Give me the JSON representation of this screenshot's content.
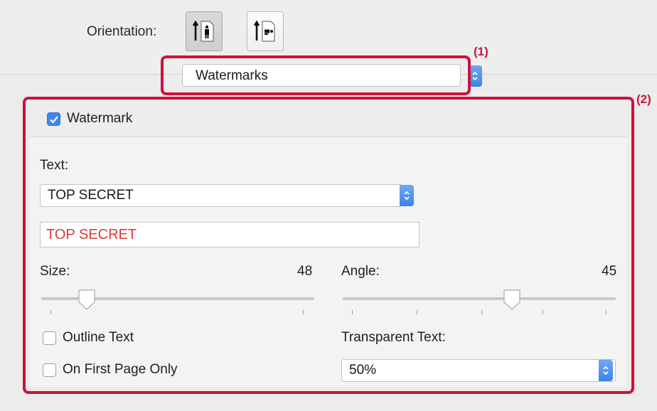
{
  "orientation": {
    "label": "Orientation:",
    "options": [
      "portrait-icon",
      "landscape-icon"
    ],
    "selected": "portrait-icon"
  },
  "panel_popup": {
    "value": "Watermarks"
  },
  "callouts": {
    "first": "(1)",
    "second": "(2)"
  },
  "watermark": {
    "checkbox_label": "Watermark",
    "checked": true,
    "text_label": "Text:",
    "text_popup_value": "TOP SECRET",
    "text_field_value": "TOP SECRET",
    "size": {
      "label": "Size:",
      "value": "48"
    },
    "angle": {
      "label": "Angle:",
      "value": "45"
    },
    "outline_text": {
      "label": "Outline Text",
      "checked": false
    },
    "first_page_only": {
      "label": "On First Page Only",
      "checked": false
    },
    "transparent": {
      "label": "Transparent Text:",
      "value": "50%"
    }
  },
  "colors": {
    "accent": "#3e86ea",
    "callout": "#d0103a",
    "text_red": "#e03a3a"
  }
}
